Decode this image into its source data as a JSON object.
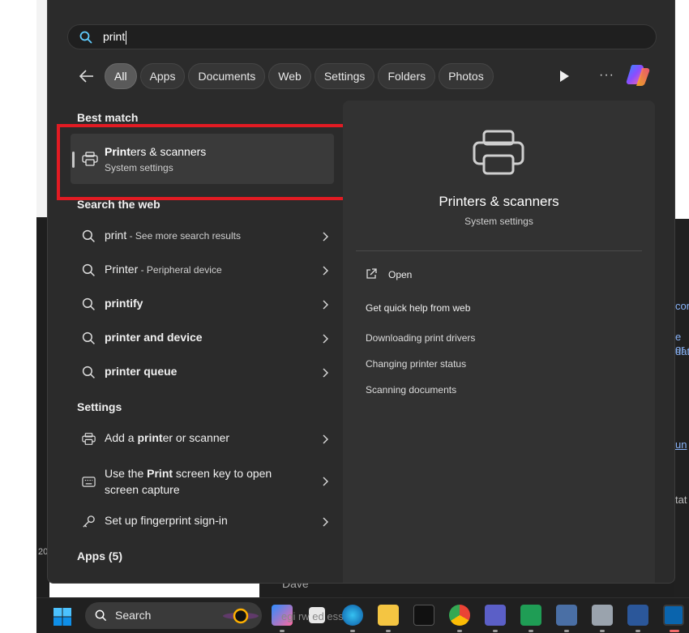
{
  "search": {
    "query": "print"
  },
  "filters": [
    {
      "label": "All",
      "active": true
    },
    {
      "label": "Apps"
    },
    {
      "label": "Documents"
    },
    {
      "label": "Web"
    },
    {
      "label": "Settings"
    },
    {
      "label": "Folders"
    },
    {
      "label": "Photos"
    }
  ],
  "more_label": "···",
  "sections": {
    "best_match": "Best match",
    "search_web": "Search the web",
    "settings": "Settings",
    "apps": "Apps (5)"
  },
  "best_match": {
    "title_bold": "Print",
    "title_rest": "ers & scanners",
    "subtitle": "System settings"
  },
  "web_results": [
    {
      "bold": "print",
      "rest": " - See more search results"
    },
    {
      "bold": "Printer",
      "rest": " - Peripheral device"
    },
    {
      "bold": "printify",
      "rest": ""
    },
    {
      "bold": "printer and device",
      "rest": ""
    },
    {
      "bold": "printer queue",
      "rest": ""
    }
  ],
  "settings_results": [
    {
      "pre": "Add a ",
      "bold": "print",
      "post": "er or scanner",
      "icon": "printer-icon"
    },
    {
      "pre": "Use the ",
      "bold": "Print",
      "post": " screen key to open screen capture",
      "icon": "keyboard-icon"
    },
    {
      "pre": "Set up fingerprint sign-in",
      "bold": "",
      "post": "",
      "icon": "key-icon"
    }
  ],
  "preview": {
    "title": "Printers & scanners",
    "subtitle": "System settings",
    "open": "Open",
    "help_header": "Get quick help from web",
    "links": [
      "Downloading print drivers",
      "Changing printer status",
      "Scanning documents"
    ]
  },
  "taskbar": {
    "search_label": "Search"
  },
  "background": {
    "frag_a": "Dave",
    "frag_b": "egi  rw  ed  essa",
    "frag_c": "20"
  },
  "colors": {
    "highlight_border": "#e21b23",
    "panel_bg": "#2b2b2b"
  }
}
